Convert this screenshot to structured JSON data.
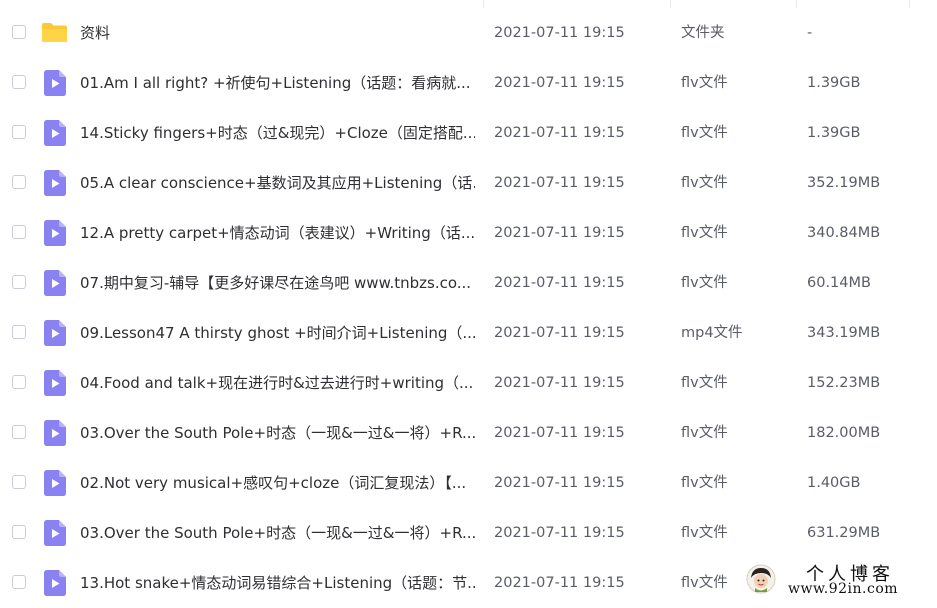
{
  "colors": {
    "folder": "#fcc934",
    "video_icon": "#8a82f0",
    "video_icon_fold": "#b8b3f7",
    "checkbox_border": "#c9ccd4"
  },
  "files": [
    {
      "icon": "folder-icon",
      "name": "资料",
      "date": "2021-07-11 19:15",
      "type": "文件夹",
      "size": "-"
    },
    {
      "icon": "video-file-icon",
      "name": "01.Am I all right? +祈使句+Listening（话题：看病就...",
      "date": "2021-07-11 19:15",
      "type": "flv文件",
      "size": "1.39GB"
    },
    {
      "icon": "video-file-icon",
      "name": "14.Sticky fingers+时态（过&现完）+Cloze（固定搭配...",
      "date": "2021-07-11 19:15",
      "type": "flv文件",
      "size": "1.39GB"
    },
    {
      "icon": "video-file-icon",
      "name": "05.A clear conscience+基数词及其应用+Listening（话...",
      "date": "2021-07-11 19:15",
      "type": "flv文件",
      "size": "352.19MB"
    },
    {
      "icon": "video-file-icon",
      "name": "12.A pretty carpet+情态动词（表建议）+Writing（话...",
      "date": "2021-07-11 19:15",
      "type": "flv文件",
      "size": "340.84MB"
    },
    {
      "icon": "video-file-icon",
      "name": "07.期中复习-辅导【更多好课尽在途鸟吧 www.tnbzs.co...",
      "date": "2021-07-11 19:15",
      "type": "flv文件",
      "size": "60.14MB"
    },
    {
      "icon": "video-file-icon",
      "name": "09.Lesson47 A thirsty ghost +时间介词+Listening（...",
      "date": "2021-07-11 19:15",
      "type": "mp4文件",
      "size": "343.19MB"
    },
    {
      "icon": "video-file-icon",
      "name": "04.Food and talk+现在进行时&过去进行时+writing（...",
      "date": "2021-07-11 19:15",
      "type": "flv文件",
      "size": "152.23MB"
    },
    {
      "icon": "video-file-icon",
      "name": "03.Over the South Pole+时态（一现&一过&一将）+R...",
      "date": "2021-07-11 19:15",
      "type": "flv文件",
      "size": "182.00MB"
    },
    {
      "icon": "video-file-icon",
      "name": "02.Not very musical+感叹句+cloze（词汇复现法）【...",
      "date": "2021-07-11 19:15",
      "type": "flv文件",
      "size": "1.40GB"
    },
    {
      "icon": "video-file-icon",
      "name": "03.Over the South Pole+时态（一现&一过&一将）+R...",
      "date": "2021-07-11 19:15",
      "type": "flv文件",
      "size": "631.29MB"
    },
    {
      "icon": "video-file-icon",
      "name": "13.Hot snake+情态动词易错综合+Listening（话题：节...",
      "date": "2021-07-11 19:15",
      "type": "flv文件",
      "size": ""
    }
  ],
  "watermark": {
    "title": "个人博客",
    "url": "www.92in.com",
    "avatar_icon": "avatar-icon"
  }
}
